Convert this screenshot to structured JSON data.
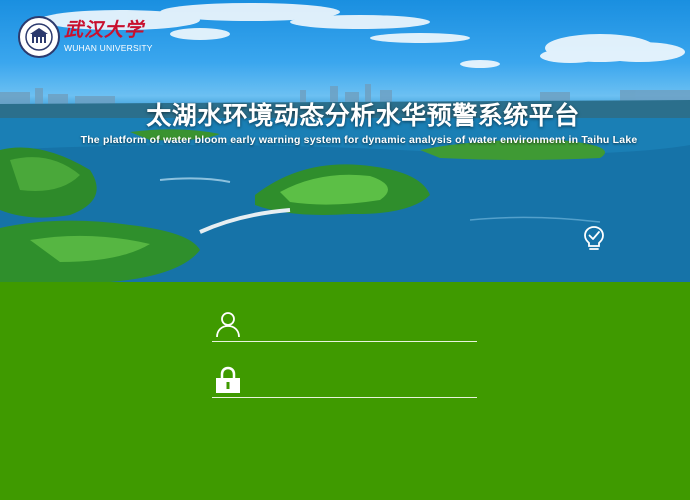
{
  "header": {
    "university_cn": "武汉大学",
    "university_en": "WUHAN UNIVERSITY",
    "title": "太湖水环境动态分析水华预警系统平台",
    "subtitle": "The platform of water bloom early warning system for dynamic analysis of water environment in Taihu Lake"
  },
  "icons": {
    "seal": "university-seal-icon",
    "bulb": "lightbulb-check-icon",
    "user": "user-icon",
    "lock": "lock-icon"
  },
  "login": {
    "username": {
      "value": "",
      "placeholder": ""
    },
    "password": {
      "value": "",
      "placeholder": ""
    }
  },
  "colors": {
    "form_background": "#3f9a00",
    "field_underline": "#e8f3dc",
    "logo_text_red": "#c8102e"
  }
}
